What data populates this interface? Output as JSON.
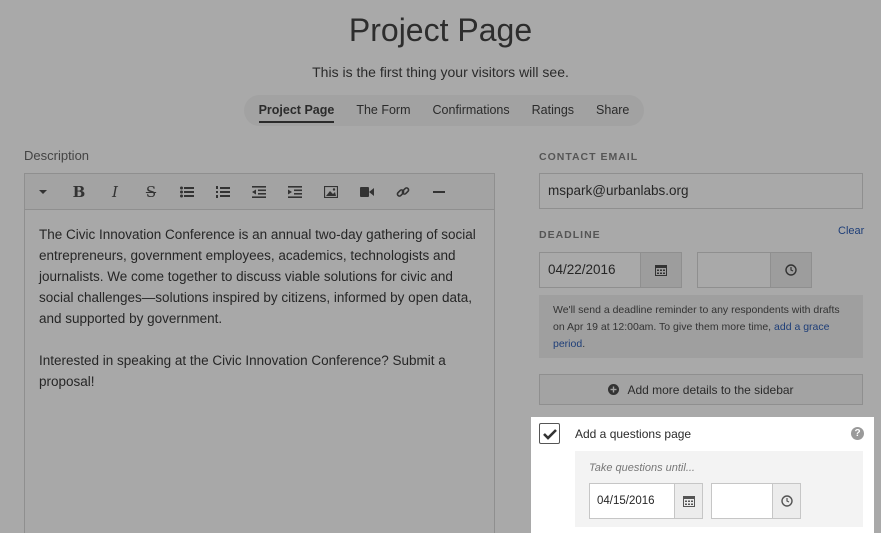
{
  "page": {
    "title": "Project Page",
    "subtitle": "This is the first thing your visitors will see."
  },
  "tabs": [
    {
      "label": "Project Page",
      "active": true
    },
    {
      "label": "The Form",
      "active": false
    },
    {
      "label": "Confirmations",
      "active": false
    },
    {
      "label": "Ratings",
      "active": false
    },
    {
      "label": "Share",
      "active": false
    }
  ],
  "description": {
    "label": "Description",
    "toolbar": [
      "dropdown-caret-icon",
      "bold-icon",
      "italic-icon",
      "strikethrough-icon",
      "bullet-list-icon",
      "numbered-list-icon",
      "outdent-icon",
      "indent-icon",
      "image-icon",
      "video-icon",
      "link-icon",
      "horizontal-rule-icon"
    ],
    "toolbar_glyphs": {
      "bold": "B",
      "italic": "I",
      "strike": "S"
    },
    "paragraphs": [
      "The Civic Innovation Conference is an annual two-day gathering of social entrepreneurs, government employees, academics, technologists and journalists. We come together to discuss viable solutions for civic and social challenges—solutions inspired by citizens, informed by open data, and supported by government.",
      "Interested in speaking at the Civic Innovation Conference? Submit a proposal!"
    ]
  },
  "contact": {
    "label": "CONTACT EMAIL",
    "value": "mspark@urbanlabs.org"
  },
  "deadline": {
    "label": "DEADLINE",
    "clear_label": "Clear",
    "date": "04/22/2016",
    "time": "",
    "notice_text": "We'll send a deadline reminder to any respondents with drafts on Apr 19 at 12:00am. To give them more time,",
    "notice_link": "add a grace period",
    "notice_end": "."
  },
  "sidebar_button": {
    "label": "Add more details to the sidebar",
    "icon": "plus-circle-icon"
  },
  "questions": {
    "checked": true,
    "label": "Add a questions page",
    "help": "?",
    "hint": "Take questions until...",
    "date": "04/15/2016",
    "time": ""
  },
  "colors": {
    "overlay": "#a9a9a9",
    "link": "#1e3e78",
    "panel": "#ffffff"
  }
}
